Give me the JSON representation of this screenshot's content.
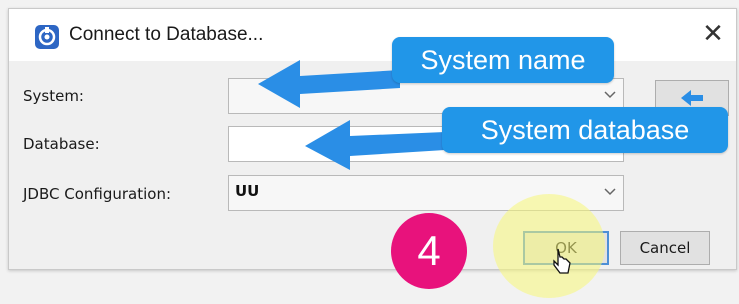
{
  "dialog": {
    "title": "Connect to Database...",
    "close_glyph": "✕",
    "app_icon": "database-connection-icon"
  },
  "form": {
    "system_label": "System:",
    "system_value": "",
    "database_label": "Database:",
    "database_value": "",
    "jdbc_label": "JDBC Configuration:",
    "jdbc_value": "UU"
  },
  "buttons": {
    "ok_label": "OK",
    "cancel_label": "Cancel",
    "side_icon": "arrow-left-icon"
  },
  "annotations": {
    "callout_system": "System name",
    "callout_database": "System database",
    "step_number": "4"
  },
  "colors": {
    "callout_blue": "#2196e8",
    "arrow_blue": "#2a8ee6",
    "step_magenta": "#e8127c",
    "highlight_yellow": "#f8f878"
  }
}
